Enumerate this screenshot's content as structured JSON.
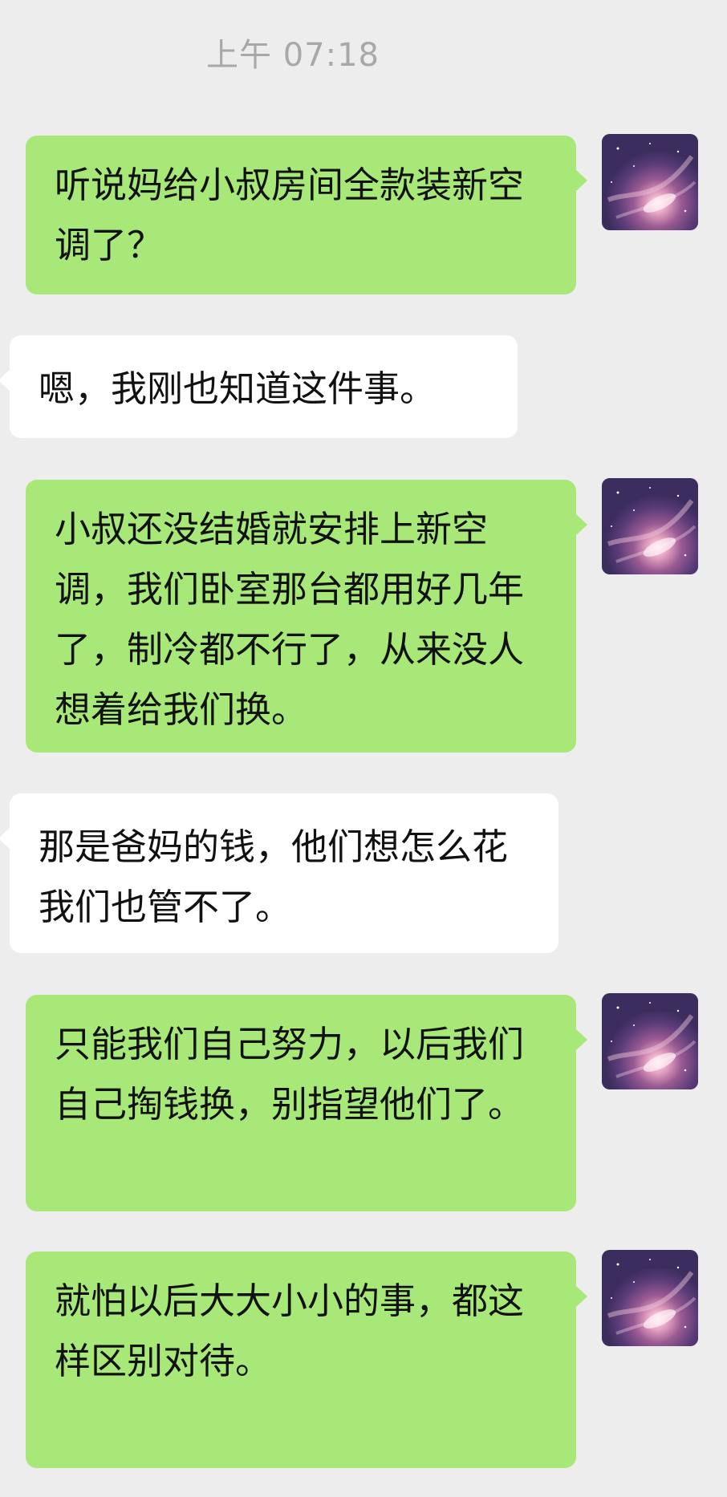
{
  "chat": {
    "timestamp": "上午 07:18",
    "messages": [
      {
        "sender": "me",
        "text": "听说妈给小叔房间全款装新空调了？"
      },
      {
        "sender": "other",
        "text": "嗯，我刚也知道这件事。"
      },
      {
        "sender": "me",
        "text": "小叔还没结婚就安排上新空调，我们卧室那台都用好几年了，制冷都不行了，从来没人想着给我们换。"
      },
      {
        "sender": "other",
        "text": "那是爸妈的钱，他们想怎么花我们也管不了。"
      },
      {
        "sender": "me",
        "text": "只能我们自己努力，以后我们自己掏钱换，别指望他们了。"
      },
      {
        "sender": "me",
        "text": "就怕以后大大小小的事，都这样区别对待。"
      }
    ]
  },
  "icons": {
    "self_avatar": "galaxy-avatar-icon"
  },
  "colors": {
    "background": "#ededed",
    "sent_bubble": "#a8e878",
    "received_bubble": "#ffffff",
    "timestamp_text": "#a8a8a8"
  }
}
